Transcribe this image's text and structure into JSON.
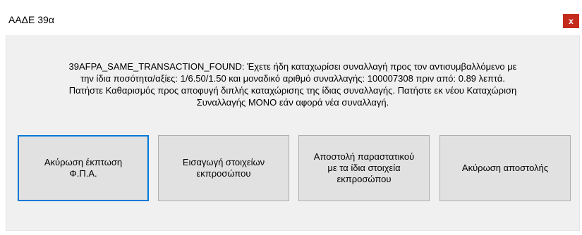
{
  "window": {
    "title": "ΑΑΔΕ 39α",
    "close_label": "x"
  },
  "message": {
    "text": "39AFPA_SAME_TRANSACTION_FOUND: Έχετε ήδη καταχωρίσει συναλλαγή προς τον αντισυμβαλλόμενο με\nτην ίδια ποσότητα/αξίες: 1/6.50/1.50 και μοναδικό αριθμό συναλλαγής: 100007308 πριν από: 0.89 λεπτά.\nΠατήστε Καθαρισμός προς αποφυγή διπλής καταχώρισης της ίδιας συναλλαγής. Πατήστε εκ νέου Καταχώριση\nΣυναλλαγής ΜΟΝΟ εάν αφορά νέα συναλλαγή."
  },
  "buttons": {
    "cancel_vat_discount": "Ακύρωση έκπτωση\nΦ.Π.Α.",
    "enter_representative": "Εισαγωγή στοιχείων\nεκπροσώπου",
    "send_same_representative": "Αποστολή παραστατικού\nμε τα ίδια στοιχεία\nεκπροσώπου",
    "cancel_send": "Ακύρωση αποστολής"
  },
  "colors": {
    "close_button": "#c42b1c",
    "focus_border": "#0078d7",
    "button_face": "#e1e1e1",
    "dialog_background": "#f0f0f0"
  }
}
